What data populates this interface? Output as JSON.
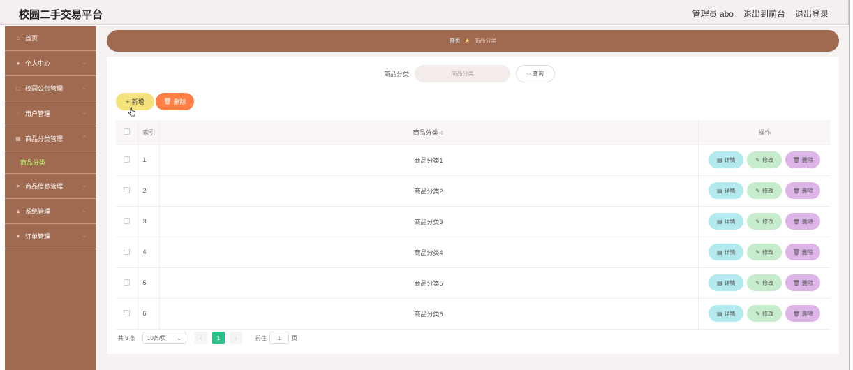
{
  "header": {
    "title": "校园二手交易平台",
    "user": "管理员 abo",
    "front_link": "退出到前台",
    "logout_link": "退出登录"
  },
  "sidebar": {
    "items": [
      {
        "label": "首页",
        "icon": "home-icon"
      },
      {
        "label": "个人中心",
        "icon": "user-icon"
      },
      {
        "label": "校园公告管理",
        "icon": "notice-icon"
      },
      {
        "label": "用户管理",
        "icon": "users-icon"
      },
      {
        "label": "商品分类管理",
        "icon": "category-icon"
      },
      {
        "label": "商品信息管理",
        "icon": "send-icon"
      },
      {
        "label": "系统管理",
        "icon": "settings-icon"
      },
      {
        "label": "订单管理",
        "icon": "order-icon"
      }
    ],
    "active_sub": "商品分类"
  },
  "breadcrumb": {
    "home": "首页",
    "current": "商品分类"
  },
  "search": {
    "label": "商品分类",
    "placeholder": "商品分类",
    "button": "查询"
  },
  "toolbar": {
    "add_label": "新增",
    "delete_label": "删除"
  },
  "table": {
    "headers": {
      "index": "索引",
      "name": "商品分类",
      "ops": "操作"
    },
    "rows": [
      {
        "index": "1",
        "name": "商品分类1"
      },
      {
        "index": "2",
        "name": "商品分类2"
      },
      {
        "index": "3",
        "name": "商品分类3"
      },
      {
        "index": "4",
        "name": "商品分类4"
      },
      {
        "index": "5",
        "name": "商品分类5"
      },
      {
        "index": "6",
        "name": "商品分类6"
      }
    ],
    "op_labels": {
      "detail": "详情",
      "edit": "修改",
      "delete": "删除"
    }
  },
  "pager": {
    "total": "共 6 条",
    "page_size": "10条/页",
    "current_page": "1",
    "goto_label": "前往",
    "goto_value": "1",
    "page_suffix": "页"
  },
  "colors": {
    "sidebar": "#a06a50",
    "active_sub": "#b9ff6a",
    "add_button": "#f4e27d",
    "delete_button": "#ff7f44",
    "detail_button": "#b2eaf0",
    "edit_button": "#c6ebcd",
    "row_delete_button": "#ddb5e8",
    "current_page": "#2bc18a"
  }
}
